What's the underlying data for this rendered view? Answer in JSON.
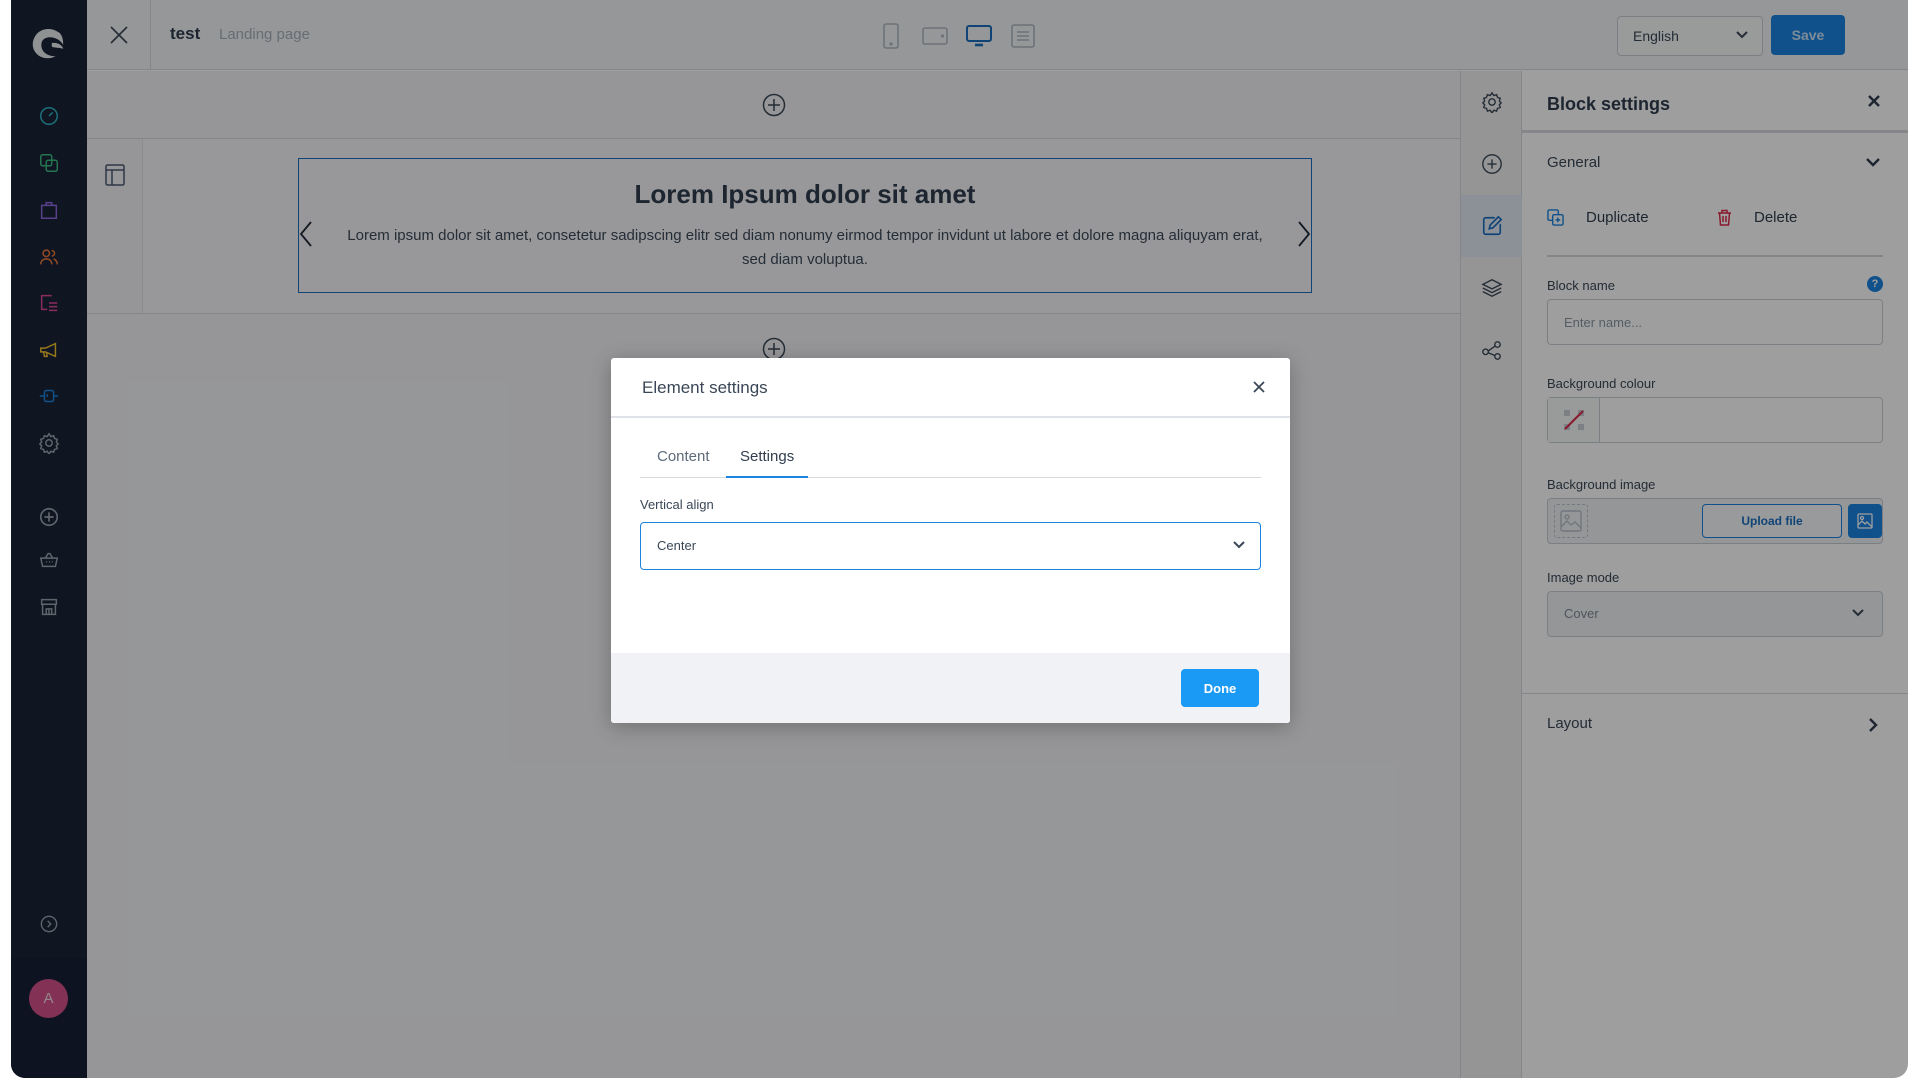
{
  "sidebar": {
    "items": [
      {
        "icon": "dashboard-icon",
        "color": "#2fb7c9"
      },
      {
        "icon": "catalogues-icon",
        "color": "#3dbb84"
      },
      {
        "icon": "orders-icon",
        "color": "#8f6ae0"
      },
      {
        "icon": "customers-icon",
        "color": "#f07a3e"
      },
      {
        "icon": "content-icon",
        "color": "#e0469b"
      },
      {
        "icon": "marketing-icon",
        "color": "#f2c12e"
      },
      {
        "icon": "extensions-icon",
        "color": "#1b84e0"
      },
      {
        "icon": "settings-icon",
        "color": "#9aa4b0"
      },
      {
        "icon": "add-icon",
        "color": "#9aa4b0"
      },
      {
        "icon": "basket-icon",
        "color": "#9aa4b0"
      },
      {
        "icon": "store-icon",
        "color": "#9aa4b0"
      }
    ],
    "collapse_icon": "chevron-right-circle-icon",
    "avatar_initial": "A"
  },
  "header": {
    "title": "test",
    "subtitle": "Landing page",
    "devices": [
      "mobile-icon",
      "tablet-landscape-icon",
      "desktop-icon",
      "list-view-icon"
    ],
    "active_device": "desktop-icon",
    "language": "English",
    "save_label": "Save"
  },
  "canvas": {
    "slider_title": "Lorem Ipsum dolor sit amet",
    "slider_text": "Lorem ipsum dolor sit amet, consetetur sadipscing elitr sed diam nonumy eirmod tempor invidunt ut labore et dolore magna aliquyam erat, sed diam voluptua."
  },
  "rail": {
    "items": [
      "settings-icon",
      "add-block-icon",
      "edit-icon",
      "layers-icon",
      "share-icon"
    ],
    "active": "edit-icon"
  },
  "panel": {
    "title": "Block settings",
    "general_label": "General",
    "duplicate_label": "Duplicate",
    "delete_label": "Delete",
    "block_name_label": "Block name",
    "block_name_placeholder": "Enter name...",
    "help_badge": "?",
    "bg_colour_label": "Background colour",
    "bg_image_label": "Background image",
    "upload_label": "Upload file",
    "image_mode_label": "Image mode",
    "image_mode_value": "Cover",
    "layout_label": "Layout"
  },
  "modal": {
    "title": "Element settings",
    "tabs": [
      {
        "label": "Content",
        "active": false
      },
      {
        "label": "Settings",
        "active": true
      }
    ],
    "vertical_align_label": "Vertical align",
    "vertical_align_value": "Center",
    "done_label": "Done"
  },
  "colors": {
    "accent": "#1b84e0",
    "sidebar_bg": "#1a2536",
    "delete_red": "#de294c"
  }
}
